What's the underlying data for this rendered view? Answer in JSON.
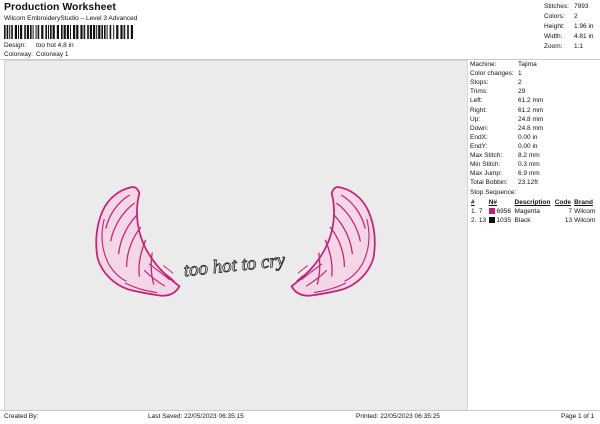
{
  "header": {
    "title": "Production Worksheet",
    "subtitle": "Wilcom EmbroideryStudio – Level 3 Advanced",
    "design_label": "Design:",
    "design_value": "too hot 4,8 in",
    "colorway_label": "Colorway:",
    "colorway_value": "Colorway 1"
  },
  "summary": [
    {
      "label": "Stitches:",
      "value": "7993"
    },
    {
      "label": "Colors:",
      "value": "2"
    },
    {
      "label": "Height:",
      "value": "1.96 in"
    },
    {
      "label": "Width:",
      "value": "4.81 in"
    },
    {
      "label": "Zoom:",
      "value": "1:1"
    }
  ],
  "machine_info": [
    {
      "label": "Machine:",
      "value": "Tajima"
    },
    {
      "label": "Color changes:",
      "value": "1"
    },
    {
      "label": "Stops:",
      "value": "2"
    },
    {
      "label": "Trims:",
      "value": "29"
    },
    {
      "label": "Left:",
      "value": "61.2 mm"
    },
    {
      "label": "Right:",
      "value": "61.2 mm"
    },
    {
      "label": "Up:",
      "value": "24.8 mm"
    },
    {
      "label": "Down:",
      "value": "24.8 mm"
    },
    {
      "label": "EndX:",
      "value": "0.00 in"
    },
    {
      "label": "EndY:",
      "value": "0.00 in"
    },
    {
      "label": "Max Stitch:",
      "value": "8.2 mm"
    },
    {
      "label": "Min Stitch:",
      "value": "0.3 mm"
    },
    {
      "label": "Max Jump:",
      "value": "6.9 mm"
    },
    {
      "label": "Total Bobbin:",
      "value": "23.12ft"
    }
  ],
  "stop_sequence": {
    "label": "Stop Sequence:",
    "columns": [
      "#",
      "N#",
      "Description",
      "Code",
      "Brand"
    ],
    "rows": [
      {
        "num": "1.",
        "n": "7",
        "swatch": "#c0207a",
        "color_num": "6956",
        "description": "Magenta",
        "code": "7",
        "brand": "Wilcom"
      },
      {
        "num": "2.",
        "n": "13",
        "swatch": "#111111",
        "color_num": "1035",
        "description": "Black",
        "code": "13",
        "brand": "Wilcom"
      }
    ]
  },
  "design": {
    "text": "too hot to cry",
    "wing_color": "#c8217a",
    "wing_fill": "#f4d7e6",
    "text_color": "#222222"
  },
  "footer": {
    "created_by": "Created By:",
    "last_saved": "Last Saved: 22/05/2023 06:35:15",
    "printed": "Printed: 22/05/2023 06:35:25",
    "page": "Page 1 of 1"
  }
}
